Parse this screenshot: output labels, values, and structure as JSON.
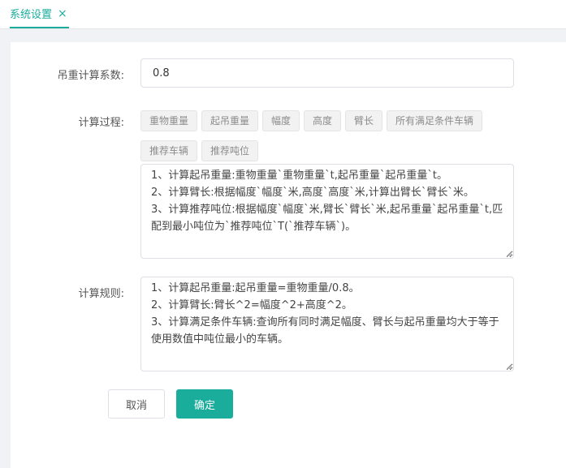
{
  "tab": {
    "title": "系统设置",
    "close_glyph": "×"
  },
  "form": {
    "coef_label": "吊重计算系数:",
    "coef_value": "0.8",
    "process_label": "计算过程:",
    "rules_label": "计算规则:",
    "tags": [
      "重物重量",
      "起吊重量",
      "幅度",
      "高度",
      "臂长",
      "所有满足条件车辆",
      "推荐车辆",
      "推荐吨位"
    ],
    "process_text": "1、计算起吊重量:重物重量`重物重量`t,起吊重量`起吊重量`t。\n2、计算臂长:根据幅度`幅度`米,高度`高度`米,计算出臂长`臂长`米。\n3、计算推荐吨位:根据幅度`幅度`米,臂长`臂长`米,起吊重量`起吊重量`t,匹配到最小吨位为`推荐吨位`T(`推荐车辆`)。",
    "rules_text": "1、计算起吊重量:起吊重量=重物重量/0.8。\n2、计算臂长:臂长^2=幅度^2+高度^2。\n3、计算满足条件车辆:查询所有同时满足幅度、臂长与起吊重量均大于等于使用数值中吨位最小的车辆。"
  },
  "buttons": {
    "cancel": "取消",
    "confirm": "确定"
  },
  "colors": {
    "accent": "#1aad9c",
    "background": "#f0f2f5",
    "tag_bg": "#f2f2f2"
  }
}
